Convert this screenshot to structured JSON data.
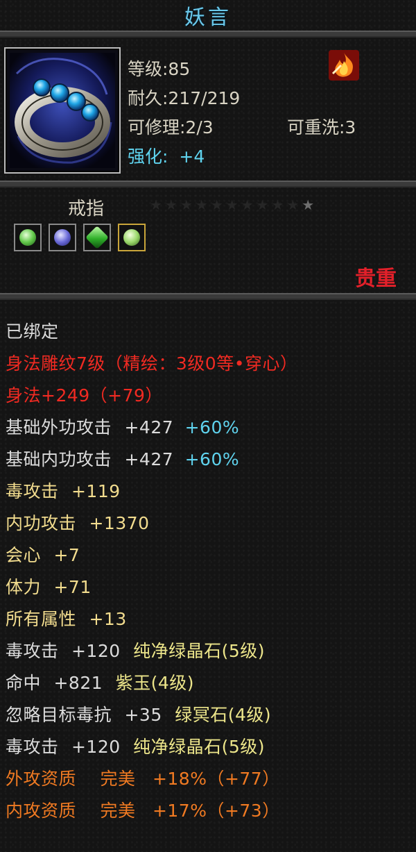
{
  "item": {
    "name": "妖言",
    "level_text": "等级:85",
    "durability_text": "耐久:217/219",
    "repair_text": "可修理:2/3",
    "rewash_text": "可重洗:3",
    "enhance_label": "强化:",
    "enhance_value": "+4",
    "type": "戒指",
    "stars": "★★★★★★★★★★★",
    "rarity": "贵重"
  },
  "icons": {
    "item_icon": "ring-icon",
    "class_icon": "flame-icon",
    "gems": [
      "green-gem-icon",
      "purple-gem-icon",
      "green-crystal-icon",
      "green-gem-icon"
    ]
  },
  "colors": {
    "title": "#6cc9ea",
    "rarity": "#e3202a",
    "base_attr": "#dcdcdc",
    "bonus": "#f2dc8e",
    "percent": "#5fd3ee",
    "engrave": "#f02a22",
    "aptitude": "#f07a22",
    "gem_name": "#ece58a"
  },
  "attributes": {
    "bound": "已绑定",
    "engrave": "身法雕纹7级（精绘：3级0等•穿心）",
    "agility": "身法+249（+79）",
    "base_ext_label": "基础外功攻击",
    "base_ext_value": "+427",
    "base_ext_pct": "+60%",
    "base_int_label": "基础内功攻击",
    "base_int_value": "+427",
    "base_int_pct": "+60%",
    "poison_label": "毒攻击",
    "poison_value": "+119",
    "int_atk_label": "内功攻击",
    "int_atk_value": "+1370",
    "crit_label": "会心",
    "crit_value": "+7",
    "stamina_label": "体力",
    "stamina_value": "+71",
    "all_attr_label": "所有属性",
    "all_attr_value": "+13",
    "gem1_label": "毒攻击",
    "gem1_value": "+120",
    "gem1_name": "纯净绿晶石(5级)",
    "gem2_label": "命中",
    "gem2_value": "+821",
    "gem2_name": "紫玉(4级)",
    "gem3_label": "忽略目标毒抗",
    "gem3_value": "+35",
    "gem3_name": "绿冥石(4级)",
    "gem4_label": "毒攻击",
    "gem4_value": "+120",
    "gem4_name": "纯净绿晶石(5级)",
    "apt_ext_label": "外攻资质",
    "apt_ext_grade": "完美",
    "apt_ext_value": "+18%（+77）",
    "apt_int_label": "内攻资质",
    "apt_int_grade": "完美",
    "apt_int_value": "+17%（+73）"
  }
}
